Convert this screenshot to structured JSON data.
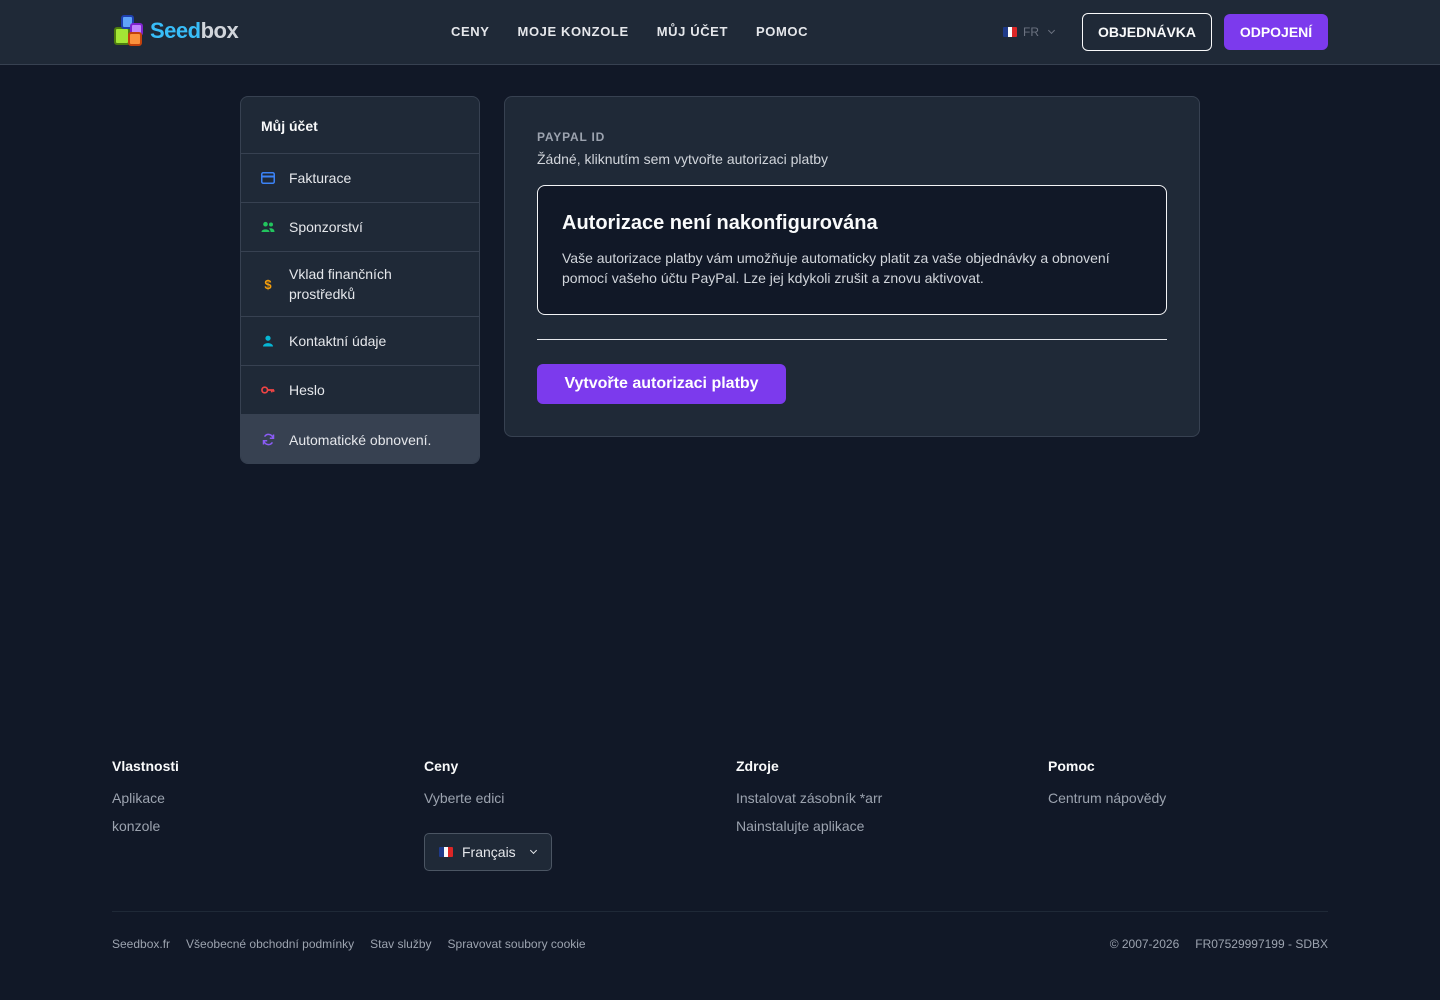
{
  "brand": {
    "logo_text_a": "Seed",
    "logo_text_b": "box"
  },
  "nav": [
    "CENY",
    "MOJE KONZOLE",
    "MŮJ ÚČET",
    "POMOC"
  ],
  "header": {
    "language": "FR",
    "order_label": "OBJEDNÁVKA",
    "logout_label": "ODPOJENÍ"
  },
  "sidebar": {
    "title": "Můj účet",
    "items": [
      {
        "label": "Fakturace",
        "icon": "credit-card-icon",
        "color": "#3b82f6"
      },
      {
        "label": "Sponzorství",
        "icon": "people-icon",
        "color": "#22c55e"
      },
      {
        "label": "Vklad finančních prostředků",
        "icon": "dollar-icon",
        "color": "#f59e0b"
      },
      {
        "label": "Kontaktní údaje",
        "icon": "person-icon",
        "color": "#06b6d4"
      },
      {
        "label": "Heslo",
        "icon": "key-icon",
        "color": "#ef4444"
      },
      {
        "label": "Automatické obnovení.",
        "icon": "refresh-icon",
        "color": "#8b5cf6",
        "active": true
      }
    ]
  },
  "main": {
    "paypal_label": "PAYPAL ID",
    "paypal_value": "Žádné, kliknutím sem vytvořte autorizaci platby",
    "notice_title": "Autorizace není nakonfigurována",
    "notice_text": "Vaše autorizace platby vám umožňuje automaticky platit za vaše objednávky a obnovení pomocí vašeho účtu PayPal. Lze jej kdykoli zrušit a znovu aktivovat.",
    "create_button": "Vytvořte autorizaci platby"
  },
  "footer": {
    "columns": [
      {
        "title": "Vlastnosti",
        "links": [
          "Aplikace",
          "konzole"
        ]
      },
      {
        "title": "Ceny",
        "links": [
          "Vyberte edici"
        ]
      },
      {
        "title": "Zdroje",
        "links": [
          "Instalovat zásobník *arr",
          "Nainstalujte aplikace"
        ]
      },
      {
        "title": "Pomoc",
        "links": [
          "Centrum nápovědy"
        ]
      }
    ],
    "language_select": "Français",
    "bottom_links": [
      "Seedbox.fr",
      "Všeobecné obchodní podmínky",
      "Stav služby",
      "Spravovat soubory cookie"
    ],
    "copyright": "© 2007-2026",
    "company_id": "FR07529997199 - SDBX"
  },
  "colors": {
    "accent": "#7c3aed",
    "background": "#111827",
    "surface": "#1f2937"
  }
}
